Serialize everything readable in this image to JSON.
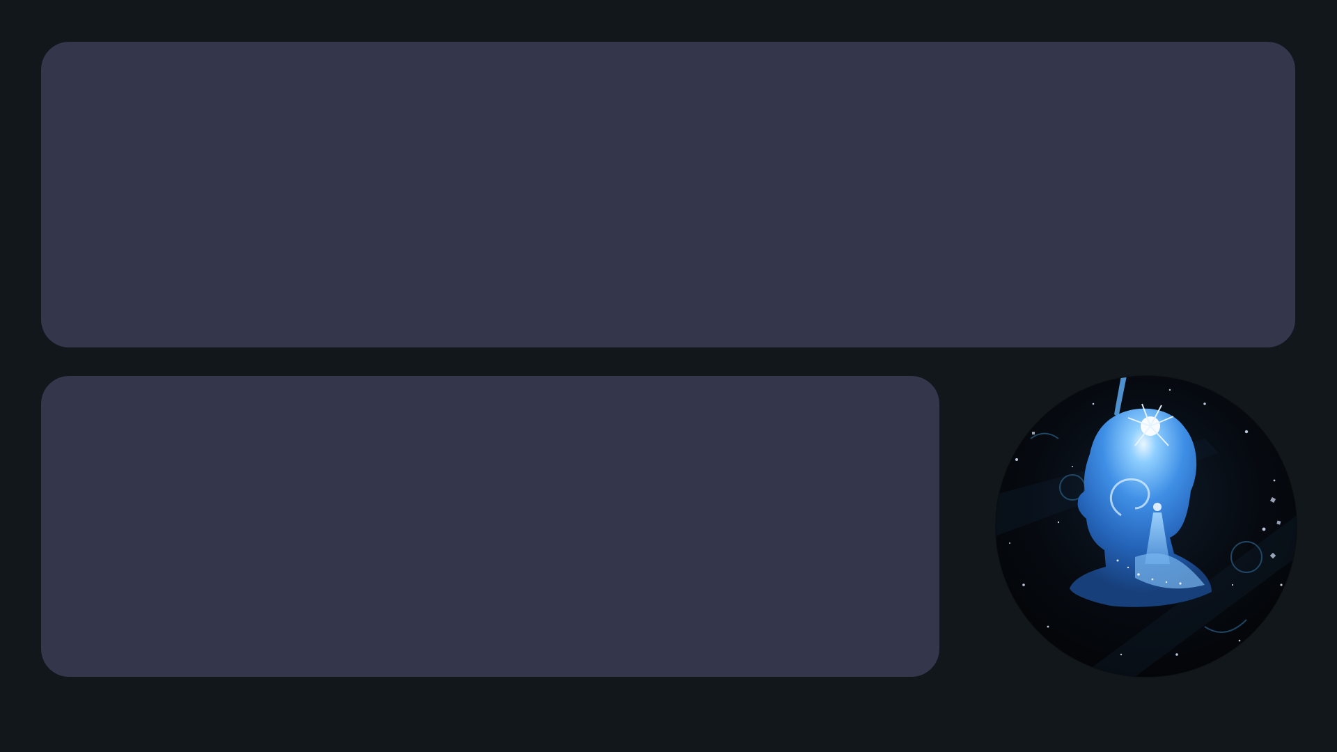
{
  "theme": {
    "background": "#12171b",
    "panel_color": "#34364b",
    "avatar_glow": "#3f8fe6"
  },
  "panels": [
    {
      "name": "top-panel"
    },
    {
      "name": "bottom-panel"
    }
  ],
  "avatar": {
    "icon": "profile-artwork"
  }
}
